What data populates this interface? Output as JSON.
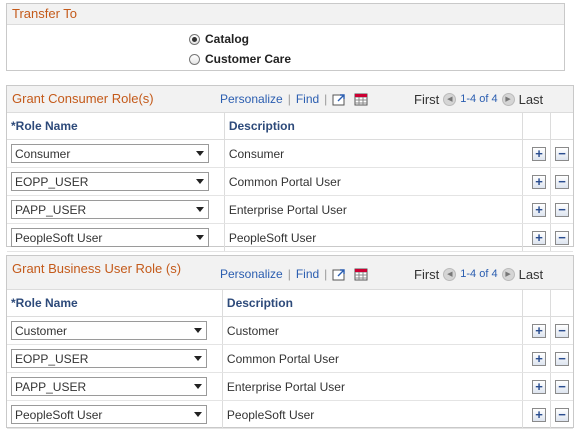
{
  "transfer": {
    "title": "Transfer To",
    "options": [
      {
        "label": "Catalog",
        "selected": true
      },
      {
        "label": "Customer Care",
        "selected": false
      }
    ]
  },
  "consumer_grid": {
    "title": "Grant Consumer Role(s)",
    "personalize": "Personalize",
    "find": "Find",
    "first": "First",
    "count": "1-4 of 4",
    "last": "Last",
    "col_role": "*Role Name",
    "col_desc": "Description",
    "rows": [
      {
        "role": "Consumer",
        "desc": "Consumer"
      },
      {
        "role": "EOPP_USER",
        "desc": "Common Portal User"
      },
      {
        "role": "PAPP_USER",
        "desc": "Enterprise Portal User"
      },
      {
        "role": "PeopleSoft User",
        "desc": "PeopleSoft User"
      }
    ]
  },
  "business_grid": {
    "title": "Grant Business User Role (s)",
    "personalize": "Personalize",
    "find": "Find",
    "first": "First",
    "count": "1-4 of 4",
    "last": "Last",
    "col_role": "*Role Name",
    "col_desc": "Description",
    "rows": [
      {
        "role": "Customer",
        "desc": "Customer"
      },
      {
        "role": "EOPP_USER",
        "desc": "Common Portal User"
      },
      {
        "role": "PAPP_USER",
        "desc": "Enterprise Portal User"
      },
      {
        "role": "PeopleSoft User",
        "desc": "PeopleSoft User"
      }
    ]
  },
  "buttons": {
    "add": "+",
    "remove": "−"
  }
}
